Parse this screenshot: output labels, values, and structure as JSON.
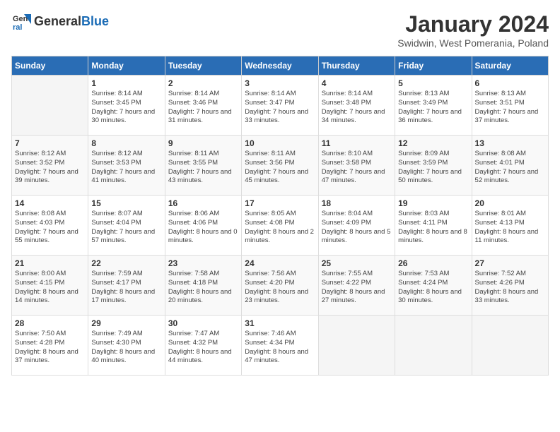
{
  "header": {
    "logo_general": "General",
    "logo_blue": "Blue",
    "month_title": "January 2024",
    "location": "Swidwin, West Pomerania, Poland"
  },
  "weekdays": [
    "Sunday",
    "Monday",
    "Tuesday",
    "Wednesday",
    "Thursday",
    "Friday",
    "Saturday"
  ],
  "weeks": [
    [
      {
        "day": "",
        "sunrise": "",
        "sunset": "",
        "daylight": ""
      },
      {
        "day": "1",
        "sunrise": "Sunrise: 8:14 AM",
        "sunset": "Sunset: 3:45 PM",
        "daylight": "Daylight: 7 hours and 30 minutes."
      },
      {
        "day": "2",
        "sunrise": "Sunrise: 8:14 AM",
        "sunset": "Sunset: 3:46 PM",
        "daylight": "Daylight: 7 hours and 31 minutes."
      },
      {
        "day": "3",
        "sunrise": "Sunrise: 8:14 AM",
        "sunset": "Sunset: 3:47 PM",
        "daylight": "Daylight: 7 hours and 33 minutes."
      },
      {
        "day": "4",
        "sunrise": "Sunrise: 8:14 AM",
        "sunset": "Sunset: 3:48 PM",
        "daylight": "Daylight: 7 hours and 34 minutes."
      },
      {
        "day": "5",
        "sunrise": "Sunrise: 8:13 AM",
        "sunset": "Sunset: 3:49 PM",
        "daylight": "Daylight: 7 hours and 36 minutes."
      },
      {
        "day": "6",
        "sunrise": "Sunrise: 8:13 AM",
        "sunset": "Sunset: 3:51 PM",
        "daylight": "Daylight: 7 hours and 37 minutes."
      }
    ],
    [
      {
        "day": "7",
        "sunrise": "Sunrise: 8:12 AM",
        "sunset": "Sunset: 3:52 PM",
        "daylight": "Daylight: 7 hours and 39 minutes."
      },
      {
        "day": "8",
        "sunrise": "Sunrise: 8:12 AM",
        "sunset": "Sunset: 3:53 PM",
        "daylight": "Daylight: 7 hours and 41 minutes."
      },
      {
        "day": "9",
        "sunrise": "Sunrise: 8:11 AM",
        "sunset": "Sunset: 3:55 PM",
        "daylight": "Daylight: 7 hours and 43 minutes."
      },
      {
        "day": "10",
        "sunrise": "Sunrise: 8:11 AM",
        "sunset": "Sunset: 3:56 PM",
        "daylight": "Daylight: 7 hours and 45 minutes."
      },
      {
        "day": "11",
        "sunrise": "Sunrise: 8:10 AM",
        "sunset": "Sunset: 3:58 PM",
        "daylight": "Daylight: 7 hours and 47 minutes."
      },
      {
        "day": "12",
        "sunrise": "Sunrise: 8:09 AM",
        "sunset": "Sunset: 3:59 PM",
        "daylight": "Daylight: 7 hours and 50 minutes."
      },
      {
        "day": "13",
        "sunrise": "Sunrise: 8:08 AM",
        "sunset": "Sunset: 4:01 PM",
        "daylight": "Daylight: 7 hours and 52 minutes."
      }
    ],
    [
      {
        "day": "14",
        "sunrise": "Sunrise: 8:08 AM",
        "sunset": "Sunset: 4:03 PM",
        "daylight": "Daylight: 7 hours and 55 minutes."
      },
      {
        "day": "15",
        "sunrise": "Sunrise: 8:07 AM",
        "sunset": "Sunset: 4:04 PM",
        "daylight": "Daylight: 7 hours and 57 minutes."
      },
      {
        "day": "16",
        "sunrise": "Sunrise: 8:06 AM",
        "sunset": "Sunset: 4:06 PM",
        "daylight": "Daylight: 8 hours and 0 minutes."
      },
      {
        "day": "17",
        "sunrise": "Sunrise: 8:05 AM",
        "sunset": "Sunset: 4:08 PM",
        "daylight": "Daylight: 8 hours and 2 minutes."
      },
      {
        "day": "18",
        "sunrise": "Sunrise: 8:04 AM",
        "sunset": "Sunset: 4:09 PM",
        "daylight": "Daylight: 8 hours and 5 minutes."
      },
      {
        "day": "19",
        "sunrise": "Sunrise: 8:03 AM",
        "sunset": "Sunset: 4:11 PM",
        "daylight": "Daylight: 8 hours and 8 minutes."
      },
      {
        "day": "20",
        "sunrise": "Sunrise: 8:01 AM",
        "sunset": "Sunset: 4:13 PM",
        "daylight": "Daylight: 8 hours and 11 minutes."
      }
    ],
    [
      {
        "day": "21",
        "sunrise": "Sunrise: 8:00 AM",
        "sunset": "Sunset: 4:15 PM",
        "daylight": "Daylight: 8 hours and 14 minutes."
      },
      {
        "day": "22",
        "sunrise": "Sunrise: 7:59 AM",
        "sunset": "Sunset: 4:17 PM",
        "daylight": "Daylight: 8 hours and 17 minutes."
      },
      {
        "day": "23",
        "sunrise": "Sunrise: 7:58 AM",
        "sunset": "Sunset: 4:18 PM",
        "daylight": "Daylight: 8 hours and 20 minutes."
      },
      {
        "day": "24",
        "sunrise": "Sunrise: 7:56 AM",
        "sunset": "Sunset: 4:20 PM",
        "daylight": "Daylight: 8 hours and 23 minutes."
      },
      {
        "day": "25",
        "sunrise": "Sunrise: 7:55 AM",
        "sunset": "Sunset: 4:22 PM",
        "daylight": "Daylight: 8 hours and 27 minutes."
      },
      {
        "day": "26",
        "sunrise": "Sunrise: 7:53 AM",
        "sunset": "Sunset: 4:24 PM",
        "daylight": "Daylight: 8 hours and 30 minutes."
      },
      {
        "day": "27",
        "sunrise": "Sunrise: 7:52 AM",
        "sunset": "Sunset: 4:26 PM",
        "daylight": "Daylight: 8 hours and 33 minutes."
      }
    ],
    [
      {
        "day": "28",
        "sunrise": "Sunrise: 7:50 AM",
        "sunset": "Sunset: 4:28 PM",
        "daylight": "Daylight: 8 hours and 37 minutes."
      },
      {
        "day": "29",
        "sunrise": "Sunrise: 7:49 AM",
        "sunset": "Sunset: 4:30 PM",
        "daylight": "Daylight: 8 hours and 40 minutes."
      },
      {
        "day": "30",
        "sunrise": "Sunrise: 7:47 AM",
        "sunset": "Sunset: 4:32 PM",
        "daylight": "Daylight: 8 hours and 44 minutes."
      },
      {
        "day": "31",
        "sunrise": "Sunrise: 7:46 AM",
        "sunset": "Sunset: 4:34 PM",
        "daylight": "Daylight: 8 hours and 47 minutes."
      },
      {
        "day": "",
        "sunrise": "",
        "sunset": "",
        "daylight": ""
      },
      {
        "day": "",
        "sunrise": "",
        "sunset": "",
        "daylight": ""
      },
      {
        "day": "",
        "sunrise": "",
        "sunset": "",
        "daylight": ""
      }
    ]
  ]
}
